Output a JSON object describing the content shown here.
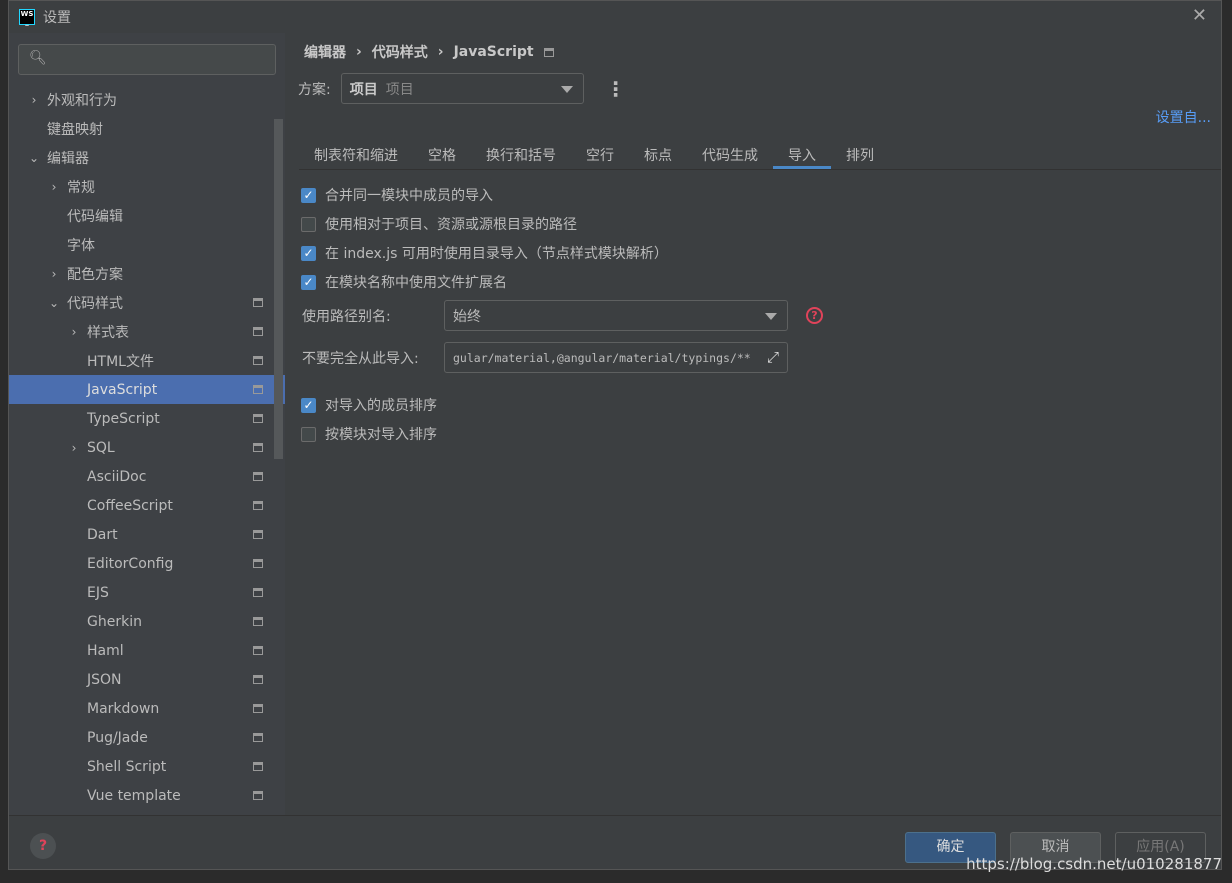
{
  "window": {
    "title": "设置",
    "logo": "WS"
  },
  "search": {
    "placeholder": ""
  },
  "tree": [
    {
      "label": "外观和行为",
      "arrow": "›",
      "indent": 0
    },
    {
      "label": "键盘映射",
      "arrow": "",
      "indent": 0
    },
    {
      "label": "编辑器",
      "arrow": "⌄",
      "indent": 0
    },
    {
      "label": "常规",
      "arrow": "›",
      "indent": 1
    },
    {
      "label": "代码编辑",
      "arrow": "",
      "indent": 1
    },
    {
      "label": "字体",
      "arrow": "",
      "indent": 1
    },
    {
      "label": "配色方案",
      "arrow": "›",
      "indent": 1
    },
    {
      "label": "代码样式",
      "arrow": "⌄",
      "indent": 1,
      "cfg": true
    },
    {
      "label": "样式表",
      "arrow": "›",
      "indent": 2,
      "cfg": true
    },
    {
      "label": "HTML文件",
      "arrow": "",
      "indent": 2,
      "cfg": true
    },
    {
      "label": "JavaScript",
      "arrow": "",
      "indent": 2,
      "cfg": true,
      "selected": true
    },
    {
      "label": "TypeScript",
      "arrow": "",
      "indent": 2,
      "cfg": true
    },
    {
      "label": "SQL",
      "arrow": "›",
      "indent": 2,
      "cfg": true
    },
    {
      "label": "AsciiDoc",
      "arrow": "",
      "indent": 2,
      "cfg": true
    },
    {
      "label": "CoffeeScript",
      "arrow": "",
      "indent": 2,
      "cfg": true
    },
    {
      "label": "Dart",
      "arrow": "",
      "indent": 2,
      "cfg": true
    },
    {
      "label": "EditorConfig",
      "arrow": "",
      "indent": 2,
      "cfg": true
    },
    {
      "label": "EJS",
      "arrow": "",
      "indent": 2,
      "cfg": true
    },
    {
      "label": "Gherkin",
      "arrow": "",
      "indent": 2,
      "cfg": true
    },
    {
      "label": "Haml",
      "arrow": "",
      "indent": 2,
      "cfg": true
    },
    {
      "label": "JSON",
      "arrow": "",
      "indent": 2,
      "cfg": true
    },
    {
      "label": "Markdown",
      "arrow": "",
      "indent": 2,
      "cfg": true
    },
    {
      "label": "Pug/Jade",
      "arrow": "",
      "indent": 2,
      "cfg": true
    },
    {
      "label": "Shell Script",
      "arrow": "",
      "indent": 2,
      "cfg": true
    },
    {
      "label": "Vue template",
      "arrow": "",
      "indent": 2,
      "cfg": true
    }
  ],
  "breadcrumb": [
    "编辑器",
    "代码样式",
    "JavaScript"
  ],
  "scheme": {
    "label": "方案:",
    "value": "项目",
    "sub": "项目"
  },
  "set_from": "设置自...",
  "tabs": [
    "制表符和缩进",
    "空格",
    "换行和括号",
    "空行",
    "标点",
    "代码生成",
    "导入",
    "排列"
  ],
  "active_tab": 6,
  "checks": [
    {
      "label": "合并同一模块中成员的导入",
      "checked": true
    },
    {
      "label": "使用相对于项目、资源或源根目录的路径",
      "checked": false
    },
    {
      "label": "在 index.js 可用时使用目录导入（节点样式模块解析）",
      "checked": true
    },
    {
      "label": "在模块名称中使用文件扩展名",
      "checked": true
    },
    {
      "label": "对导入的成员排序",
      "checked": true
    },
    {
      "label": "按模块对导入排序",
      "checked": false
    }
  ],
  "alias": {
    "label": "使用路径别名:",
    "value": "始终"
  },
  "no_import": {
    "label": "不要完全从此导入:",
    "value": "gular/material,@angular/material/typings/**"
  },
  "buttons": {
    "ok": "确定",
    "cancel": "取消",
    "apply": "应用(A)"
  },
  "watermark": "https://blog.csdn.net/u010281877",
  "colors": {
    "accent": "#4a88c7",
    "selected": "#4b6eaf",
    "help": "#e0435a"
  }
}
